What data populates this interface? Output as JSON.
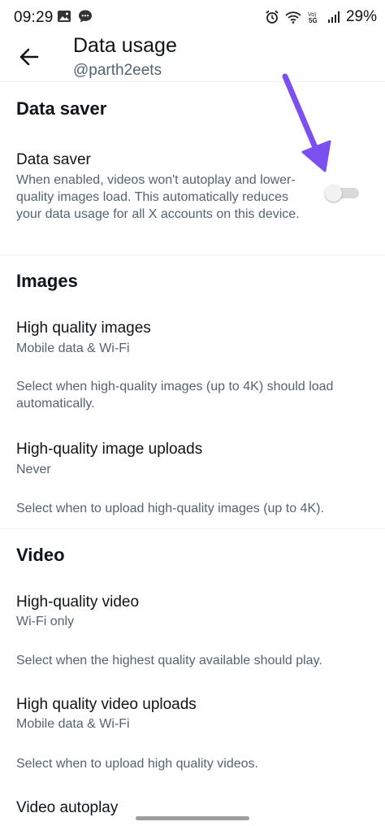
{
  "status_bar": {
    "time": "09:29",
    "battery": "29%",
    "net_label": "VoLTE 5G"
  },
  "header": {
    "title": "Data usage",
    "handle": "@parth2eets"
  },
  "sections": {
    "data_saver": {
      "title": "Data saver",
      "item_title": "Data saver",
      "item_desc": "When enabled, videos won't autoplay and lower-quality images load. This automatically reduces your data usage for all X accounts on this device.",
      "toggle_on": false
    },
    "images": {
      "title": "Images",
      "items": [
        {
          "title": "High quality images",
          "value": "Mobile data & Wi-Fi",
          "desc": "Select when high-quality images (up to 4K) should load automatically."
        },
        {
          "title": "High-quality image uploads",
          "value": "Never",
          "desc": "Select when to upload high-quality images (up to 4K)."
        }
      ]
    },
    "video": {
      "title": "Video",
      "items": [
        {
          "title": "High-quality video",
          "value": "Wi-Fi only",
          "desc": "Select when the highest quality available should play."
        },
        {
          "title": "High quality video uploads",
          "value": "Mobile data & Wi-Fi",
          "desc": "Select when to upload high quality videos."
        },
        {
          "title": "Video autoplay"
        }
      ]
    }
  },
  "colors": {
    "accent_arrow": "#7b4ff0",
    "secondary_text": "#536471",
    "primary_text": "#0f1419"
  }
}
